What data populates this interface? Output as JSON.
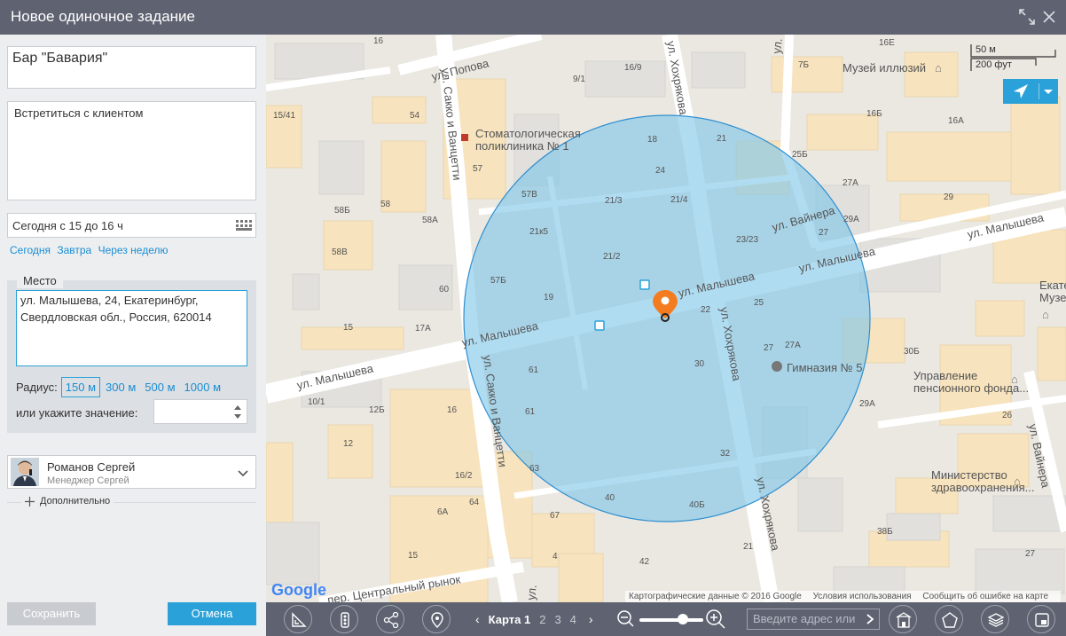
{
  "window": {
    "title": "Новое одиночное задание",
    "expand_icon": "expand-icon",
    "close_icon": "close-icon"
  },
  "form": {
    "name": "Бар \"Бавария\"",
    "description": "Встретиться с клиентом",
    "date": "Сегодня с 15 до 16 ч",
    "quick_dates": [
      "Сегодня",
      "Завтра",
      "Через неделю"
    ],
    "place_label": "Место",
    "address_line1": "ул. Малышева, 24, Екатеринбург,",
    "address_line2": "Свердловская обл., Россия, 620014",
    "radius_label": "Радиус:",
    "radius_options": [
      "150 м",
      "300 м",
      "500 м",
      "1000 м"
    ],
    "radius_selected": "150 м",
    "custom_value_label": "или укажите значение:",
    "custom_value": "",
    "assignee_name": "Романов Сергей",
    "assignee_role": "Менеджер Сергей",
    "more_label": "Дополнительно",
    "save_label": "Сохранить",
    "cancel_label": "Отмена"
  },
  "map": {
    "scale_top": "50 м",
    "scale_bottom": "200 фут",
    "attribution": "Картографические данные © 2016 Google",
    "terms": "Условия использования",
    "report": "Сообщить об ошибке на карте",
    "google_logo": "Google",
    "accent": "#2aa2d9",
    "circle_fill": "#7cc4ea",
    "pin_color": "#f47c20",
    "streets": {
      "popova": "ул. Попова",
      "sakko_top": "ул. Сакко и Ванцетти",
      "sakko_bottom": "ул. Сакко и Ванцетти",
      "khokhryakova_top": "ул. Хохрякова",
      "khokhryakova_mid": "ул. Хохрякова",
      "khokhryakova_bottom": "ул. Хохрякова",
      "malysheva_w": "ул. Малышева",
      "malysheva_sw": "ул. Малышева",
      "malysheva_c": "ул. Малышева",
      "malysheva_e": "ул. Малышева",
      "malysheva_ne": "ул. Малышева",
      "vainera_top": "ул. Вайнера",
      "vainera_e": "ул. Вайнера",
      "tsentralny": "пер. Центральный рынок",
      "ul_top_right": "ул."
    },
    "places": {
      "stomat_1": "Стоматологическая",
      "stomat_2": "поликлиника № 1",
      "museum": "Музей иллюзий",
      "gymnasium": "Гимназия № 5",
      "pension_1": "Управление",
      "pension_2": "пенсионного фонда...",
      "ministry_1": "Министерство",
      "ministry_2": "здравоохранения...",
      "ekat_1": "Екатер",
      "ekat_2": "Музей"
    },
    "house_numbers": [
      "16",
      "16/9",
      "9/1",
      "7Б",
      "16Е",
      "15/41",
      "54",
      "57",
      "58Б",
      "58",
      "58А",
      "58В",
      "57В",
      "18",
      "24",
      "21/3",
      "21/4",
      "21",
      "25Б",
      "16Б",
      "16А",
      "29",
      "27А",
      "29А",
      "27",
      "21к5",
      "21/2",
      "23/23",
      "57Б",
      "19",
      "22",
      "25",
      "60",
      "15",
      "17А",
      "27",
      "27А",
      "30Б",
      "30",
      "10/1",
      "12Б",
      "16",
      "61",
      "61",
      "12",
      "16/2",
      "32",
      "29А",
      "26",
      "63",
      "64",
      "6А",
      "40",
      "40Б",
      "67",
      "42",
      "21",
      "38Б",
      "15",
      "4",
      "27"
    ]
  },
  "toolbar": {
    "maps_label": "Карта 1",
    "pages": [
      "2",
      "3",
      "4"
    ],
    "search_placeholder": "Введите адрес или"
  }
}
